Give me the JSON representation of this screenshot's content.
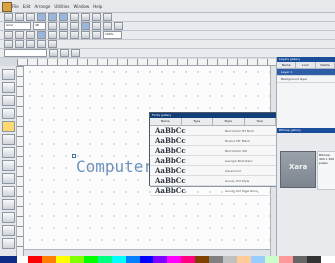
{
  "menu": {
    "items": [
      "File",
      "Edit",
      "Arrange",
      "Utilities",
      "Window",
      "Help"
    ]
  },
  "toolbar": {
    "font_select": "Arial",
    "font_size": "48",
    "zoom": "100%",
    "selected_tool": "Text tool"
  },
  "canvas": {
    "text": "Computer"
  },
  "font_gallery": {
    "title": "Fonts gallery",
    "tabs": [
      "Name",
      "Type",
      "Style",
      "Size"
    ],
    "rows": [
      {
        "sample": "AaBbCc",
        "name": "Bell Gothic BT Bold"
      },
      {
        "sample": "AaBbCc",
        "name": "Bodoni MT Black"
      },
      {
        "sample": "AaBbCc",
        "name": "Bell Gothic Std"
      },
      {
        "sample": "AaBbCc",
        "name": "Georgia Bold Italic"
      },
      {
        "sample": "AaBbCc",
        "name": "Garamond"
      },
      {
        "sample": "AaBbCc",
        "name": "Goudy Old Style"
      },
      {
        "sample": "AaBbCc",
        "name": "Goudy Old Style Bold"
      }
    ]
  },
  "layers_panel": {
    "title": "Layers gallery",
    "headers": [
      "Name",
      "Lock",
      "Visible"
    ],
    "layers": [
      "Layer 1",
      "Background layer"
    ]
  },
  "bitmap_panel": {
    "title": "Bitmap gallery",
    "preview_text": "Xara",
    "info": "Bitmap: 400 x 300 pixels"
  },
  "colors": {
    "palette": [
      "#000000",
      "#ffffff",
      "#ff0000",
      "#ff8000",
      "#ffff00",
      "#80ff00",
      "#00ff00",
      "#00ff80",
      "#00ffff",
      "#0080ff",
      "#0000ff",
      "#8000ff",
      "#ff00ff",
      "#ff0080",
      "#804000",
      "#808080",
      "#c0c0c0",
      "#ffcc99",
      "#99ccff",
      "#ccffcc",
      "#ff9999",
      "#666666",
      "#333333",
      "#ffffff"
    ]
  }
}
